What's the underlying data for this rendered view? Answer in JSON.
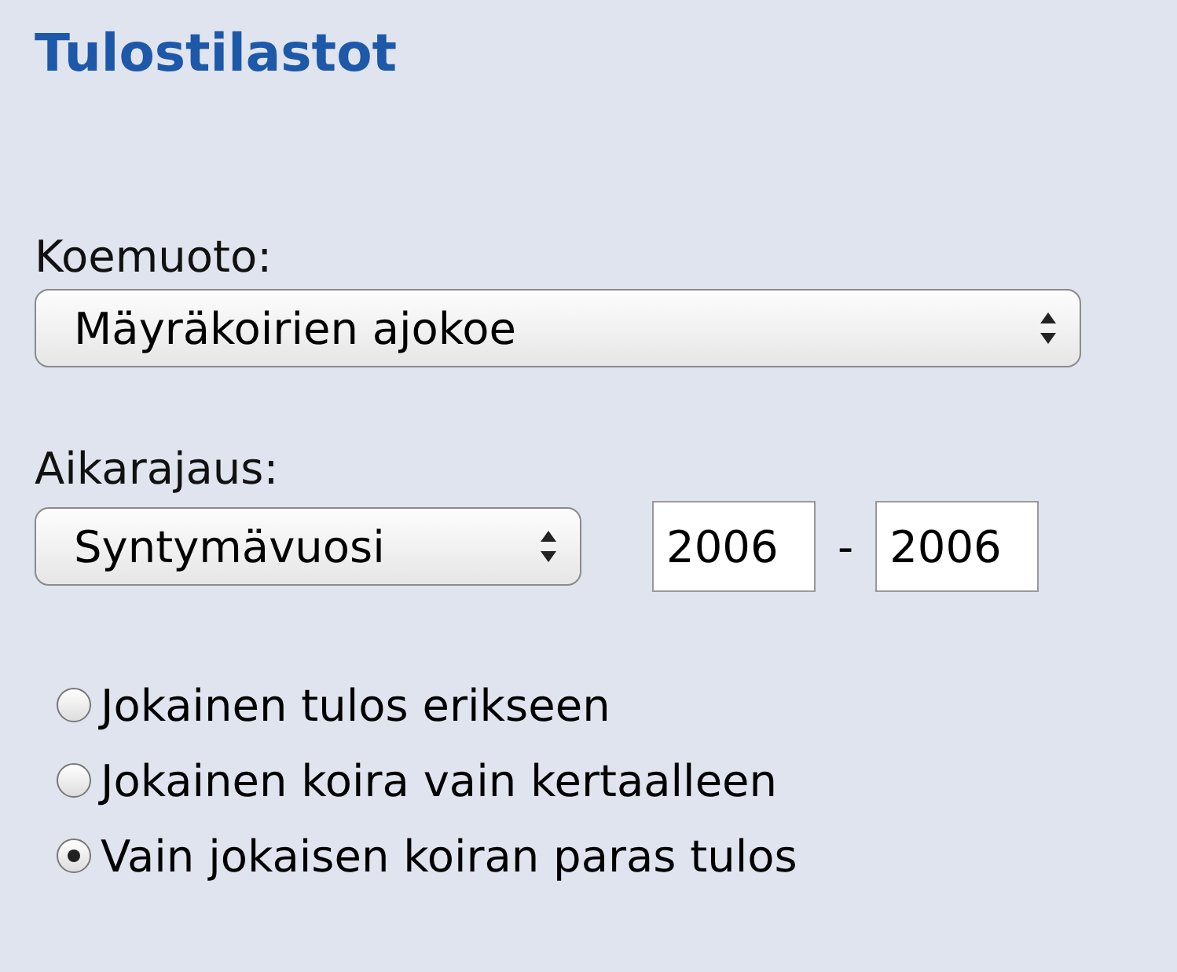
{
  "title": "Tulostilastot",
  "test_type": {
    "label": "Koemuoto:",
    "value": "Mäyräkoirien ajokoe"
  },
  "time_range": {
    "label": "Aikarajaus:",
    "value": "Syntymävuosi",
    "from": "2006",
    "separator": "-",
    "to": "2006"
  },
  "options": [
    {
      "label": "Jokainen tulos erikseen",
      "selected": false
    },
    {
      "label": "Jokainen koira vain kertaalleen",
      "selected": false
    },
    {
      "label": "Vain jokaisen koiran paras tulos",
      "selected": true
    }
  ]
}
